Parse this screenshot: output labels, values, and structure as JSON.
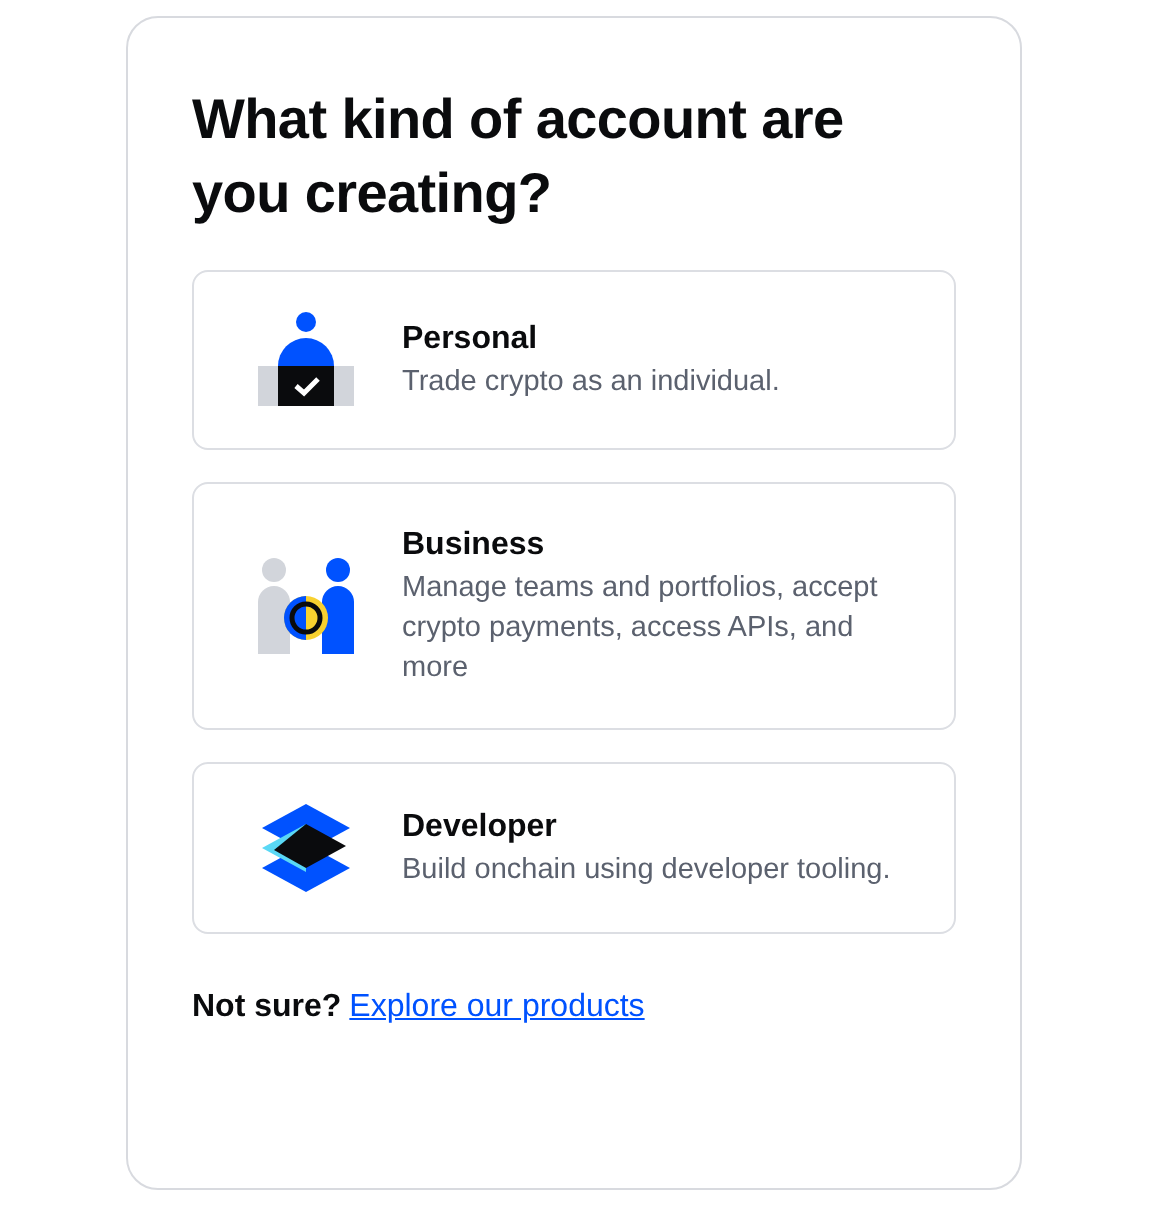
{
  "title": "What kind of account are you creating?",
  "options": [
    {
      "kind": "personal",
      "title": "Personal",
      "description": "Trade crypto as an individual."
    },
    {
      "kind": "business",
      "title": "Business",
      "description": "Manage teams and portfolios, accept crypto payments, access APIs, and more"
    },
    {
      "kind": "developer",
      "title": "Developer",
      "description": "Build onchain using developer tooling."
    }
  ],
  "footer": {
    "text": "Not sure?",
    "link": "Explore our products"
  }
}
